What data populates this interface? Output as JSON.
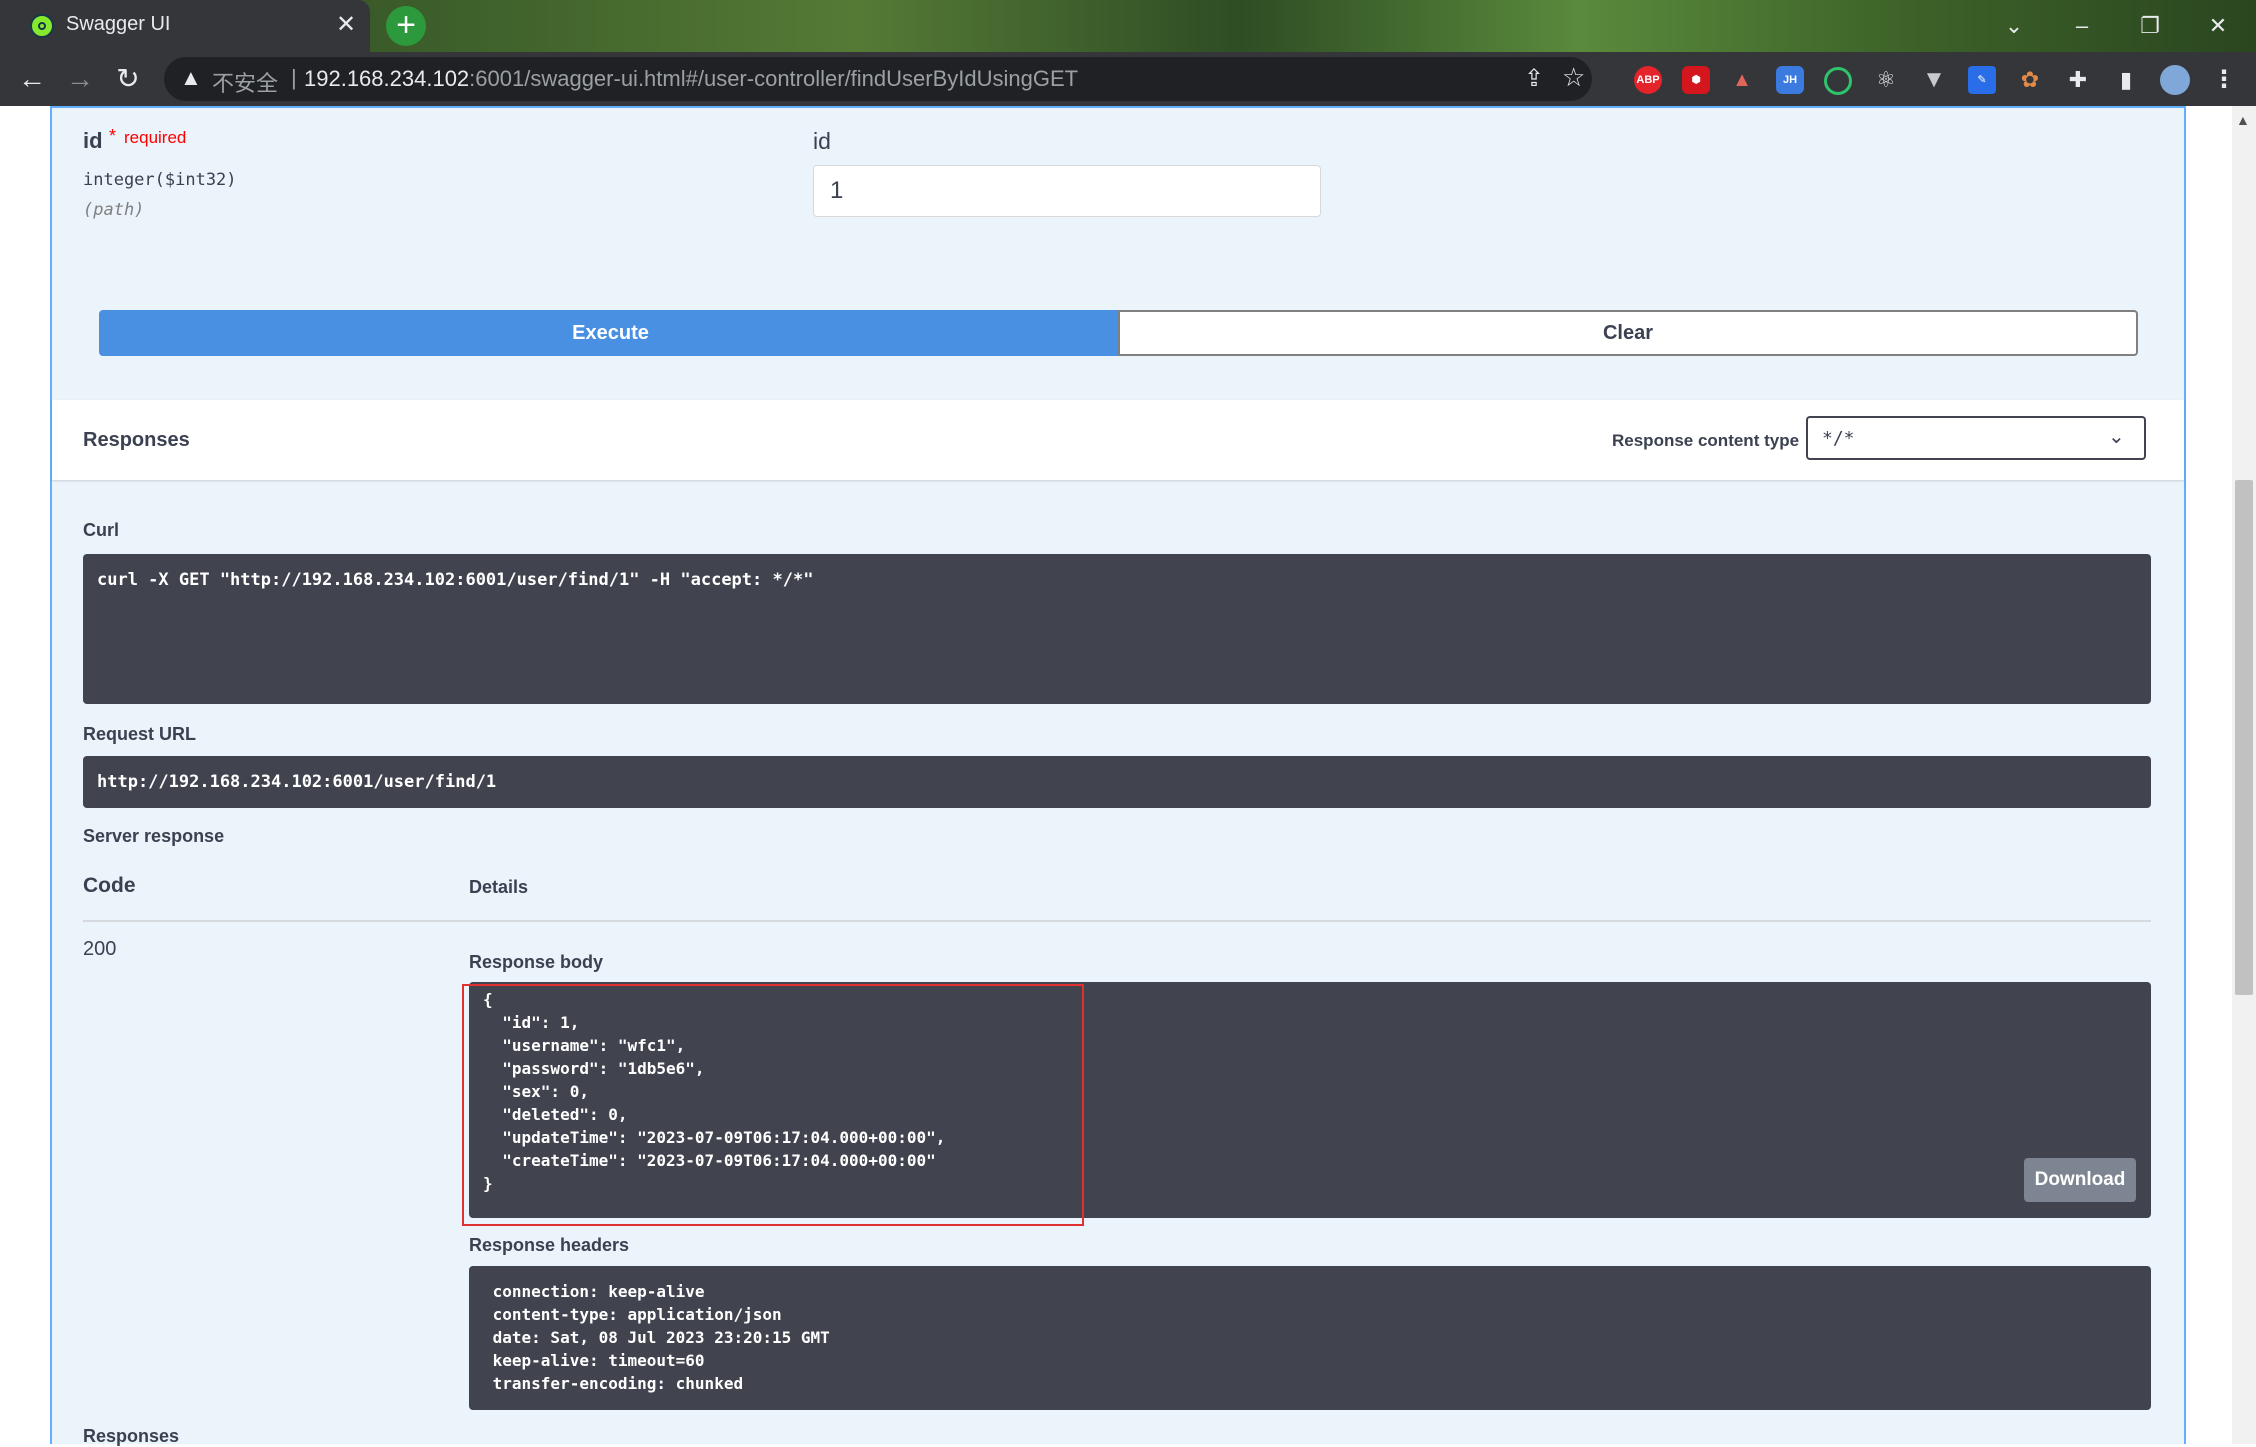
{
  "browser": {
    "tab_title": "Swagger UI",
    "tab_close": "✕",
    "new_tab": "+",
    "not_secure": "不安全",
    "separator": "|",
    "url_host": "192.168.234.102",
    "url_rest": ":6001/swagger-ui.html#/user-controller/findUserByIdUsingGET",
    "extensions": [
      "ABP",
      "JH"
    ]
  },
  "params": {
    "name": "id",
    "required_mark": "*",
    "required_label": "required",
    "type": "integer($int32)",
    "location": "(path)",
    "input_placeholder": "id",
    "input_value": "1"
  },
  "actions": {
    "execute_label": "Execute",
    "clear_label": "Clear"
  },
  "responses_header": {
    "title": "Responses",
    "content_type_label": "Response content type",
    "content_type_value": "*/*"
  },
  "curl": {
    "label": "Curl",
    "command": "curl -X GET \"http://192.168.234.102:6001/user/find/1\" -H \"accept: */*\""
  },
  "request_url": {
    "label": "Request URL",
    "value": "http://192.168.234.102:6001/user/find/1"
  },
  "server_response": {
    "label": "Server response",
    "code_header": "Code",
    "details_header": "Details",
    "code": "200",
    "body_label": "Response body",
    "body": "{\n  \"id\": 1,\n  \"username\": \"wfc1\",\n  \"password\": \"1db5e6\",\n  \"sex\": 0,\n  \"deleted\": 0,\n  \"updateTime\": \"2023-07-09T06:17:04.000+00:00\",\n  \"createTime\": \"2023-07-09T06:17:04.000+00:00\"\n}",
    "download_label": "Download",
    "headers_label": "Response headers",
    "headers": " connection: keep-alive \n content-type: application/json \n date: Sat, 08 Jul 2023 23:20:15 GMT \n keep-alive: timeout=60 \n transfer-encoding: chunked "
  },
  "footer_responses": "Responses",
  "colors": {
    "execute": "#4990e2",
    "opblock_bg": "#ebf3fb",
    "opblock_border": "#61affe",
    "code_bg": "#41444e",
    "required": "#ff0000",
    "highlight": "#e03030"
  }
}
